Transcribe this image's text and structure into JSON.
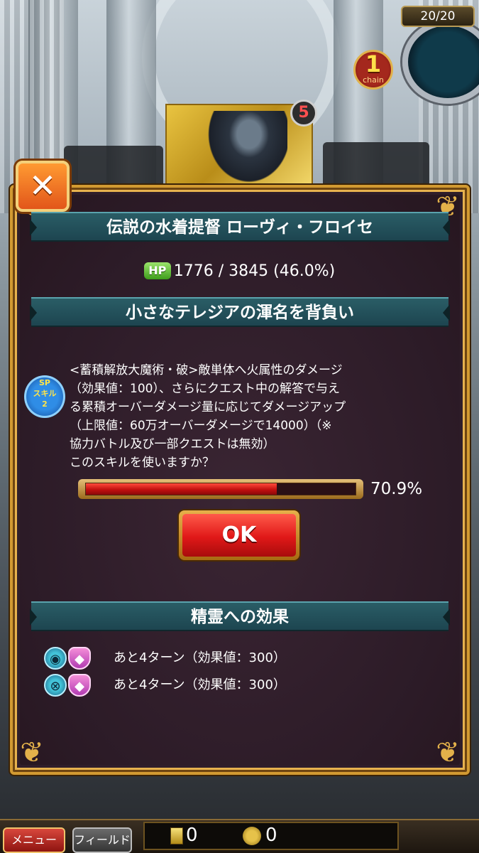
{
  "hud": {
    "stamina": "20/20",
    "chain_count": "1",
    "chain_label": "chain"
  },
  "card": {
    "cost": "5"
  },
  "dialog": {
    "title": "伝説の水着提督 ローヴィ・フロイセ",
    "hp": {
      "icon_label": "HP",
      "text": "1776 / 3845 (46.0%)"
    },
    "skill_name": "小さなテレジアの渾名を背負い",
    "sp_badge": {
      "line1": "SP",
      "line2": "スキル",
      "line3": "2"
    },
    "skill_description": [
      "<蓄積解放大魔術・破>敵単体へ火属性のダメージ",
      "（効果値：100）、さらにクエスト中の解答で与え",
      "る累積オーバーダメージ量に応じてダメージアップ",
      "（上限値：60万オーバーダメージで14000）（※",
      "協力バトル及び一部クエストは無効）",
      "このスキルを使いますか？"
    ],
    "gauge": {
      "fraction": 0.709,
      "label": "70.9%"
    },
    "ok_label": "OK",
    "effects_header": "精霊への効果",
    "effects": [
      {
        "text": "あと4ターン（効果値：300）",
        "icon_a": "eye-shield-icon",
        "icon_b": "shield-icon"
      },
      {
        "text": "あと4ターン（効果値：300）",
        "icon_a": "eye-cross-icon",
        "icon_b": "shield-icon"
      }
    ]
  },
  "bottom_bar": {
    "menu_label": "メニュー",
    "field_label": "フィールド",
    "resource1_value": "0",
    "resource2_value": "0"
  },
  "colors": {
    "accent_gold": "#d29a32",
    "banner_teal": "#1d4550",
    "gauge_red": "#e01818",
    "ok_red": "#e01818"
  }
}
